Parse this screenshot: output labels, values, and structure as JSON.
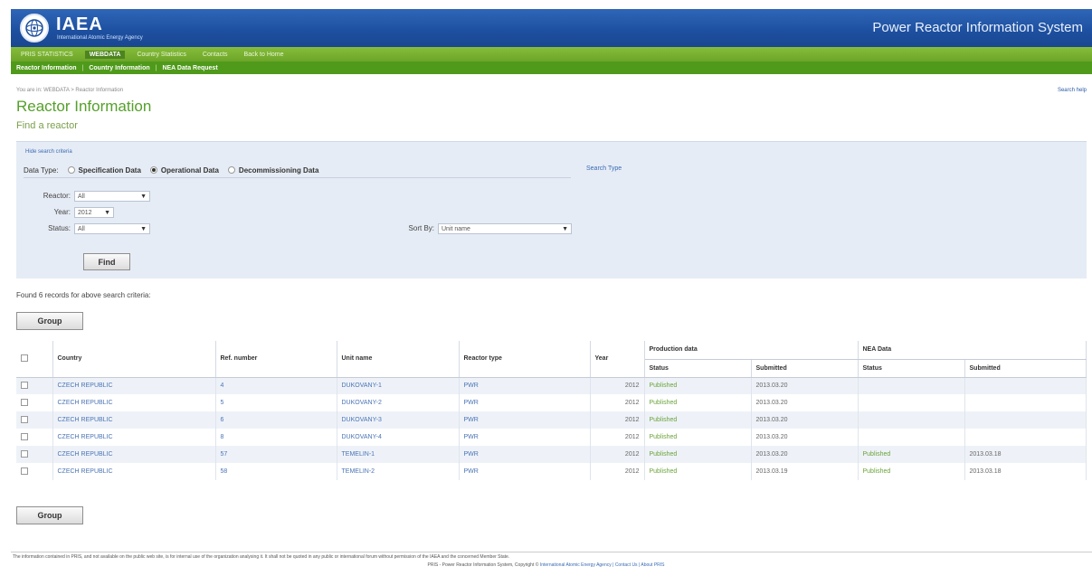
{
  "header": {
    "logo_text": "IAEA",
    "logo_sub": "International Atomic Energy Agency",
    "system_title": "Power Reactor Information System"
  },
  "nav1": [
    "PRIS STATISTICS",
    "WEBDATA",
    "Country Statistics",
    "Contacts",
    "Back to Home"
  ],
  "nav2": [
    "Reactor Information",
    "Country Information",
    "NEA Data Request"
  ],
  "breadcrumb": "You are in: WEBDATA > Reactor Information",
  "search_help": "Search help",
  "page": {
    "title": "Reactor Information",
    "subtitle": "Find a reactor"
  },
  "search": {
    "hide_criteria": "Hide search criteria",
    "data_type_label": "Data Type:",
    "options": [
      "Specification Data",
      "Operational Data",
      "Decommissioning Data"
    ],
    "selected_option": 1,
    "search_type": "Search Type",
    "reactor_label": "Reactor:",
    "reactor_value": "All",
    "year_label": "Year:",
    "year_value": "2012",
    "status_label": "Status:",
    "status_value": "All",
    "sortby_label": "Sort By:",
    "sortby_value": "Unit name",
    "find_label": "Find"
  },
  "found_text": "Found 6 records for above search criteria:",
  "group_label": "Group",
  "table": {
    "headers": {
      "country": "Country",
      "ref": "Ref. number",
      "unit": "Unit name",
      "type": "Reactor type",
      "year": "Year",
      "production": "Production data",
      "nea": "NEA Data",
      "status": "Status",
      "submitted": "Submitted"
    },
    "rows": [
      {
        "country": "CZECH REPUBLIC",
        "ref": "4",
        "unit": "DUKOVANY-1",
        "type": "PWR",
        "year": "2012",
        "p_status": "Published",
        "p_sub": "2013.03.20",
        "n_status": "",
        "n_sub": ""
      },
      {
        "country": "CZECH REPUBLIC",
        "ref": "5",
        "unit": "DUKOVANY-2",
        "type": "PWR",
        "year": "2012",
        "p_status": "Published",
        "p_sub": "2013.03.20",
        "n_status": "",
        "n_sub": ""
      },
      {
        "country": "CZECH REPUBLIC",
        "ref": "6",
        "unit": "DUKOVANY-3",
        "type": "PWR",
        "year": "2012",
        "p_status": "Published",
        "p_sub": "2013.03.20",
        "n_status": "",
        "n_sub": ""
      },
      {
        "country": "CZECH REPUBLIC",
        "ref": "8",
        "unit": "DUKOVANY-4",
        "type": "PWR",
        "year": "2012",
        "p_status": "Published",
        "p_sub": "2013.03.20",
        "n_status": "",
        "n_sub": ""
      },
      {
        "country": "CZECH REPUBLIC",
        "ref": "57",
        "unit": "TEMELIN-1",
        "type": "PWR",
        "year": "2012",
        "p_status": "Published",
        "p_sub": "2013.03.20",
        "n_status": "Published",
        "n_sub": "2013.03.18"
      },
      {
        "country": "CZECH REPUBLIC",
        "ref": "58",
        "unit": "TEMELIN-2",
        "type": "PWR",
        "year": "2012",
        "p_status": "Published",
        "p_sub": "2013.03.19",
        "n_status": "Published",
        "n_sub": "2013.03.18"
      }
    ]
  },
  "footer": {
    "notice": "The information contained in PRIS, and not available on the public web site, is for internal use of the organization analysing it. It shall not be quoted in any public or international forum without permission of the IAEA and the concerned Member State.",
    "copyright": "PRIS - Power Reactor Information System, Copyright ©",
    "links": "International Atomic Energy Agency | Contact Us | About PRIS"
  }
}
